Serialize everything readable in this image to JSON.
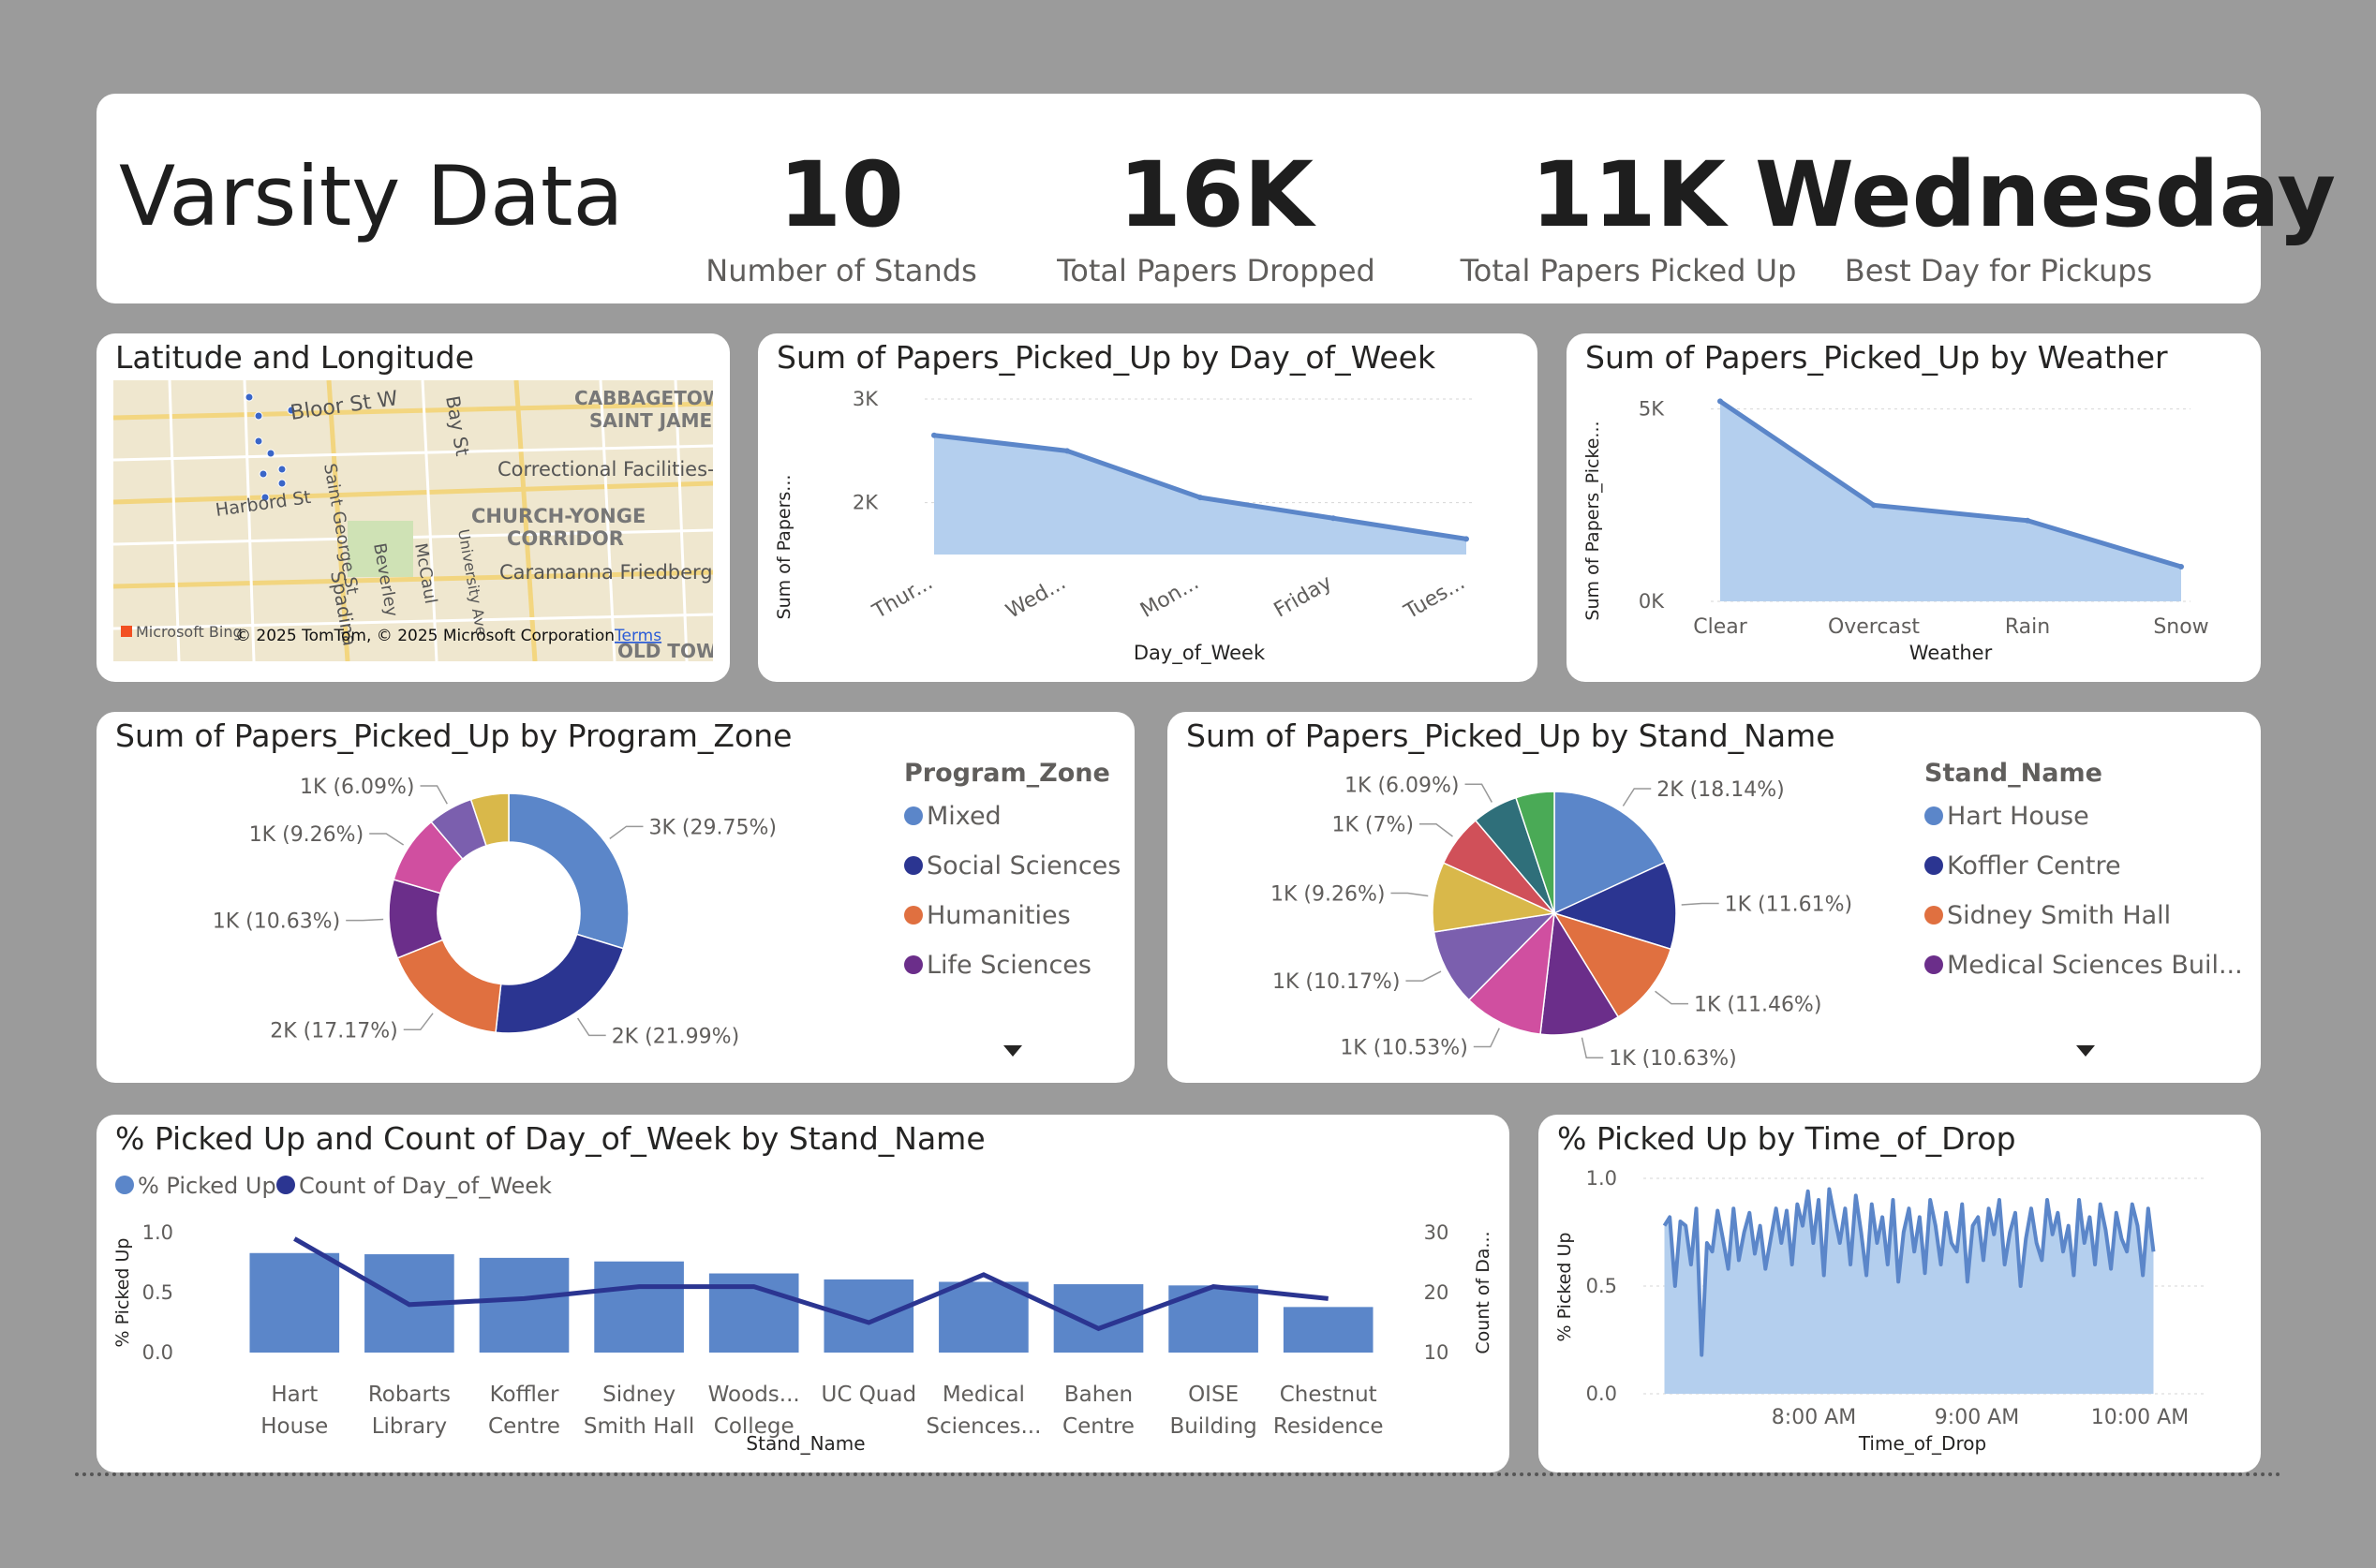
{
  "header": {
    "title": "Varsity Data",
    "kpis": [
      {
        "value": "10",
        "label": "Number of Stands"
      },
      {
        "value": "16K",
        "label": "Total Papers Dropped"
      },
      {
        "value": "11K",
        "label": "Total Papers Picked Up"
      },
      {
        "value": "Wednesday",
        "label": "Best Day for Pickups"
      }
    ]
  },
  "map": {
    "title": "Latitude and Longitude",
    "labels": {
      "bloor": "Bloor St W",
      "bay": "Bay St",
      "harbord": "Harbord St",
      "stgeorge": "Saint George St",
      "spadina": "Spadina",
      "beverley": "Beverley",
      "mccaul": "McCaul",
      "university": "University Ave",
      "cabbagetown": "CABBAGETOW",
      "saintjames": "SAINT JAMES",
      "correctional": "Correctional Facilities-",
      "church1": "CHURCH-YONGE",
      "church2": "CORRIDOR",
      "caramanna": "Caramanna Friedberg",
      "oldtown": "OLD TOW"
    },
    "bing": "Microsoft Bing",
    "copyright": "© 2025 TomTom, © 2025 Microsoft Corporation",
    "terms": "Terms",
    "pin_color": "#3a66c8"
  },
  "colors": {
    "accent": "#5b86c9",
    "area": "#b4cfee",
    "line_dark": "#2b3591",
    "pie": [
      "#5b86c9",
      "#2b3591",
      "#e07040",
      "#6b2e8a",
      "#d04fa0",
      "#7b5fae",
      "#d9b84a",
      "#d05059",
      "#2f6f7a",
      "#4aaa56"
    ]
  },
  "chart_data": [
    {
      "type": "area",
      "title": "Sum of Papers_Picked_Up by Day_of_Week",
      "xlabel": "Day_of_Week",
      "ylabel": "Sum of Papers...",
      "categories": [
        "Thur...",
        "Wed...",
        "Mon...",
        "Friday",
        "Tues..."
      ],
      "values": [
        2650,
        2500,
        2050,
        1850,
        1650
      ],
      "yticks": [
        "2K",
        "3K"
      ],
      "ylim": [
        1500,
        3000
      ],
      "grid": true
    },
    {
      "type": "area",
      "title": "Sum of Papers_Picked_Up by Weather",
      "xlabel": "Weather",
      "ylabel": "Sum of Papers_Picke...",
      "categories": [
        "Clear",
        "Overcast",
        "Rain",
        "Snow"
      ],
      "values": [
        5200,
        2500,
        2100,
        900
      ],
      "yticks": [
        "0K",
        "5K"
      ],
      "ylim": [
        0,
        5600
      ],
      "grid": true
    },
    {
      "type": "pie",
      "variant": "donut",
      "title": "Sum of Papers_Picked_Up by Program_Zone",
      "legend_title": "Program_Zone",
      "legend": [
        "Mixed",
        "Social Sciences",
        "Humanities",
        "Life Sciences"
      ],
      "values": [
        29.75,
        21.99,
        17.17,
        10.63,
        9.26,
        6.09,
        5.11
      ],
      "labels": [
        "3K (29.75%)",
        "2K (21.99%)",
        "2K (17.17%)",
        "1K (10.63%)",
        "1K (9.26%)",
        "1K (6.09%)",
        ""
      ]
    },
    {
      "type": "pie",
      "title": "Sum of Papers_Picked_Up by Stand_Name",
      "legend_title": "Stand_Name",
      "legend": [
        "Hart House",
        "Koffler Centre",
        "Sidney Smith Hall",
        "Medical Sciences Buil..."
      ],
      "values": [
        18.14,
        11.61,
        11.46,
        10.63,
        10.53,
        10.17,
        9.26,
        7.0,
        6.09,
        5.11
      ],
      "labels": [
        "2K (18.14%)",
        "1K (11.61%)",
        "1K (11.46%)",
        "1K (10.63%)",
        "1K (10.53%)",
        "1K (10.17%)",
        "1K (9.26%)",
        "1K (7%)",
        "1K (6.09%)",
        ""
      ]
    },
    {
      "type": "bar",
      "title": "% Picked Up and Count of Day_of_Week by Stand_Name",
      "xlabel": "Stand_Name",
      "ylabel": "% Picked Up",
      "y2label": "Count of Da...",
      "legend": [
        "% Picked Up",
        "Count of Day_of_Week"
      ],
      "categories": [
        [
          "Hart",
          "House"
        ],
        [
          "Robarts",
          "Library"
        ],
        [
          "Koffler",
          "Centre"
        ],
        [
          "Sidney",
          "Smith Hall"
        ],
        [
          "Woods...",
          "College"
        ],
        [
          "UC Quad",
          ""
        ],
        [
          "Medical",
          "Sciences..."
        ],
        [
          "Bahen",
          "Centre"
        ],
        [
          "OISE",
          "Building"
        ],
        [
          "Chestnut",
          "Residence"
        ]
      ],
      "series": [
        {
          "name": "% Picked Up",
          "values": [
            0.83,
            0.82,
            0.79,
            0.76,
            0.66,
            0.61,
            0.59,
            0.57,
            0.56,
            0.38
          ]
        },
        {
          "name": "Count of Day_of_Week",
          "values": [
            29,
            18,
            19,
            21,
            21,
            15,
            23,
            14,
            21,
            19
          ]
        }
      ],
      "yticks": [
        "0.0",
        "0.5",
        "1.0"
      ],
      "y2ticks": [
        "10",
        "20",
        "30"
      ],
      "ylim": [
        0,
        1.0
      ],
      "y2lim": [
        10,
        30
      ]
    },
    {
      "type": "line",
      "title": "% Picked Up by Time_of_Drop",
      "xlabel": "Time_of_Drop",
      "ylabel": "% Picked Up",
      "xticks": [
        "8:00 AM",
        "9:00 AM",
        "10:00 AM"
      ],
      "yticks": [
        "0.0",
        "0.5",
        "1.0"
      ],
      "ylim": [
        0,
        1.0
      ],
      "x_minutes": [
        420,
        620
      ],
      "values": [
        0.78,
        0.82,
        0.5,
        0.8,
        0.78,
        0.6,
        0.86,
        0.18,
        0.7,
        0.66,
        0.85,
        0.72,
        0.58,
        0.86,
        0.62,
        0.75,
        0.84,
        0.65,
        0.78,
        0.58,
        0.72,
        0.86,
        0.7,
        0.85,
        0.6,
        0.88,
        0.78,
        0.94,
        0.7,
        0.9,
        0.55,
        0.95,
        0.82,
        0.7,
        0.86,
        0.6,
        0.92,
        0.75,
        0.55,
        0.88,
        0.7,
        0.82,
        0.6,
        0.9,
        0.52,
        0.75,
        0.86,
        0.66,
        0.82,
        0.56,
        0.9,
        0.78,
        0.6,
        0.84,
        0.7,
        0.66,
        0.88,
        0.52,
        0.78,
        0.82,
        0.62,
        0.86,
        0.74,
        0.9,
        0.6,
        0.75,
        0.84,
        0.5,
        0.72,
        0.86,
        0.7,
        0.62,
        0.9,
        0.74,
        0.84,
        0.66,
        0.78,
        0.55,
        0.9,
        0.7,
        0.82,
        0.6,
        0.88,
        0.76,
        0.58,
        0.84,
        0.72,
        0.66,
        0.88,
        0.78,
        0.55,
        0.86,
        0.66
      ]
    }
  ]
}
